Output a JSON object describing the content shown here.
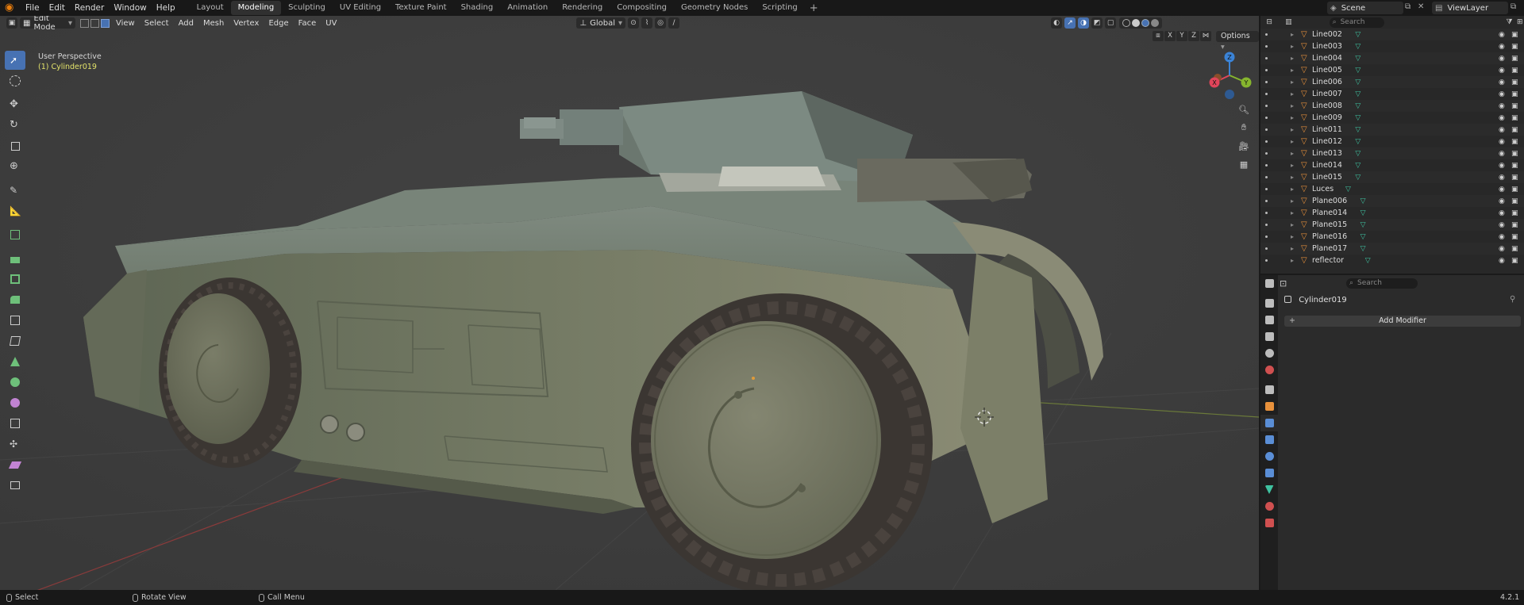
{
  "app": {
    "logo_icon": "blender-logo-icon"
  },
  "menu": [
    "File",
    "Edit",
    "Render",
    "Window",
    "Help"
  ],
  "workspaces": [
    "Layout",
    "Modeling",
    "Sculpting",
    "UV Editing",
    "Texture Paint",
    "Shading",
    "Animation",
    "Rendering",
    "Compositing",
    "Geometry Nodes",
    "Scripting"
  ],
  "active_workspace": "Modeling",
  "scene": {
    "label": "Scene",
    "view_layer": "ViewLayer"
  },
  "viewport": {
    "mode": "Edit Mode",
    "menus": [
      "View",
      "Select",
      "Add",
      "Mesh",
      "Vertex",
      "Edge",
      "Face",
      "UV"
    ],
    "transform_orientation": "Global",
    "perspective_label": "User Perspective",
    "active_object_label": "(1) Cylinder019",
    "mirror_axes": [
      "X",
      "Y",
      "Z"
    ],
    "options_label": "Options",
    "gizmo": {
      "x": "X",
      "y": "Y",
      "z": "Z"
    }
  },
  "outliner": {
    "search_placeholder": "Search",
    "items": [
      {
        "name": "Line002",
        "data_icon": "mesh-data-icon"
      },
      {
        "name": "Line003",
        "data_icon": "mesh-data-icon"
      },
      {
        "name": "Line004",
        "data_icon": "mesh-data-icon"
      },
      {
        "name": "Line005",
        "data_icon": "mesh-data-icon"
      },
      {
        "name": "Line006",
        "data_icon": "mesh-data-icon"
      },
      {
        "name": "Line007",
        "data_icon": "mesh-data-icon"
      },
      {
        "name": "Line008",
        "data_icon": "mesh-data-icon"
      },
      {
        "name": "Line009",
        "data_icon": "mesh-data-icon"
      },
      {
        "name": "Line011",
        "data_icon": "mesh-data-icon"
      },
      {
        "name": "Line012",
        "data_icon": "mesh-data-icon"
      },
      {
        "name": "Line013",
        "data_icon": "mesh-data-icon"
      },
      {
        "name": "Line014",
        "data_icon": "mesh-data-icon"
      },
      {
        "name": "Line015",
        "data_icon": "mesh-data-icon"
      },
      {
        "name": "Luces",
        "data_icon": "mesh-data-icon"
      },
      {
        "name": "Plane006",
        "data_icon": "mesh-data-icon"
      },
      {
        "name": "Plane014",
        "data_icon": "mesh-data-icon"
      },
      {
        "name": "Plane015",
        "data_icon": "mesh-data-icon"
      },
      {
        "name": "Plane016",
        "data_icon": "mesh-data-icon"
      },
      {
        "name": "Plane017",
        "data_icon": "mesh-data-icon"
      },
      {
        "name": "reflector",
        "data_icon": "mesh-data-icon"
      }
    ]
  },
  "properties": {
    "search_placeholder": "Search",
    "object_name": "Cylinder019",
    "add_modifier_label": "Add Modifier"
  },
  "statusbar": {
    "select": "Select",
    "rotate": "Rotate View",
    "call_menu": "Call Menu",
    "version": "4.2.1"
  },
  "colors": {
    "accent": "#4772b3",
    "object_orange": "#e8913b",
    "mesh_teal": "#3fc2a0",
    "active_yellow": "#e3e36a",
    "axis_x": "#e0455a",
    "axis_y": "#86b52e",
    "axis_z": "#3b83d6"
  }
}
